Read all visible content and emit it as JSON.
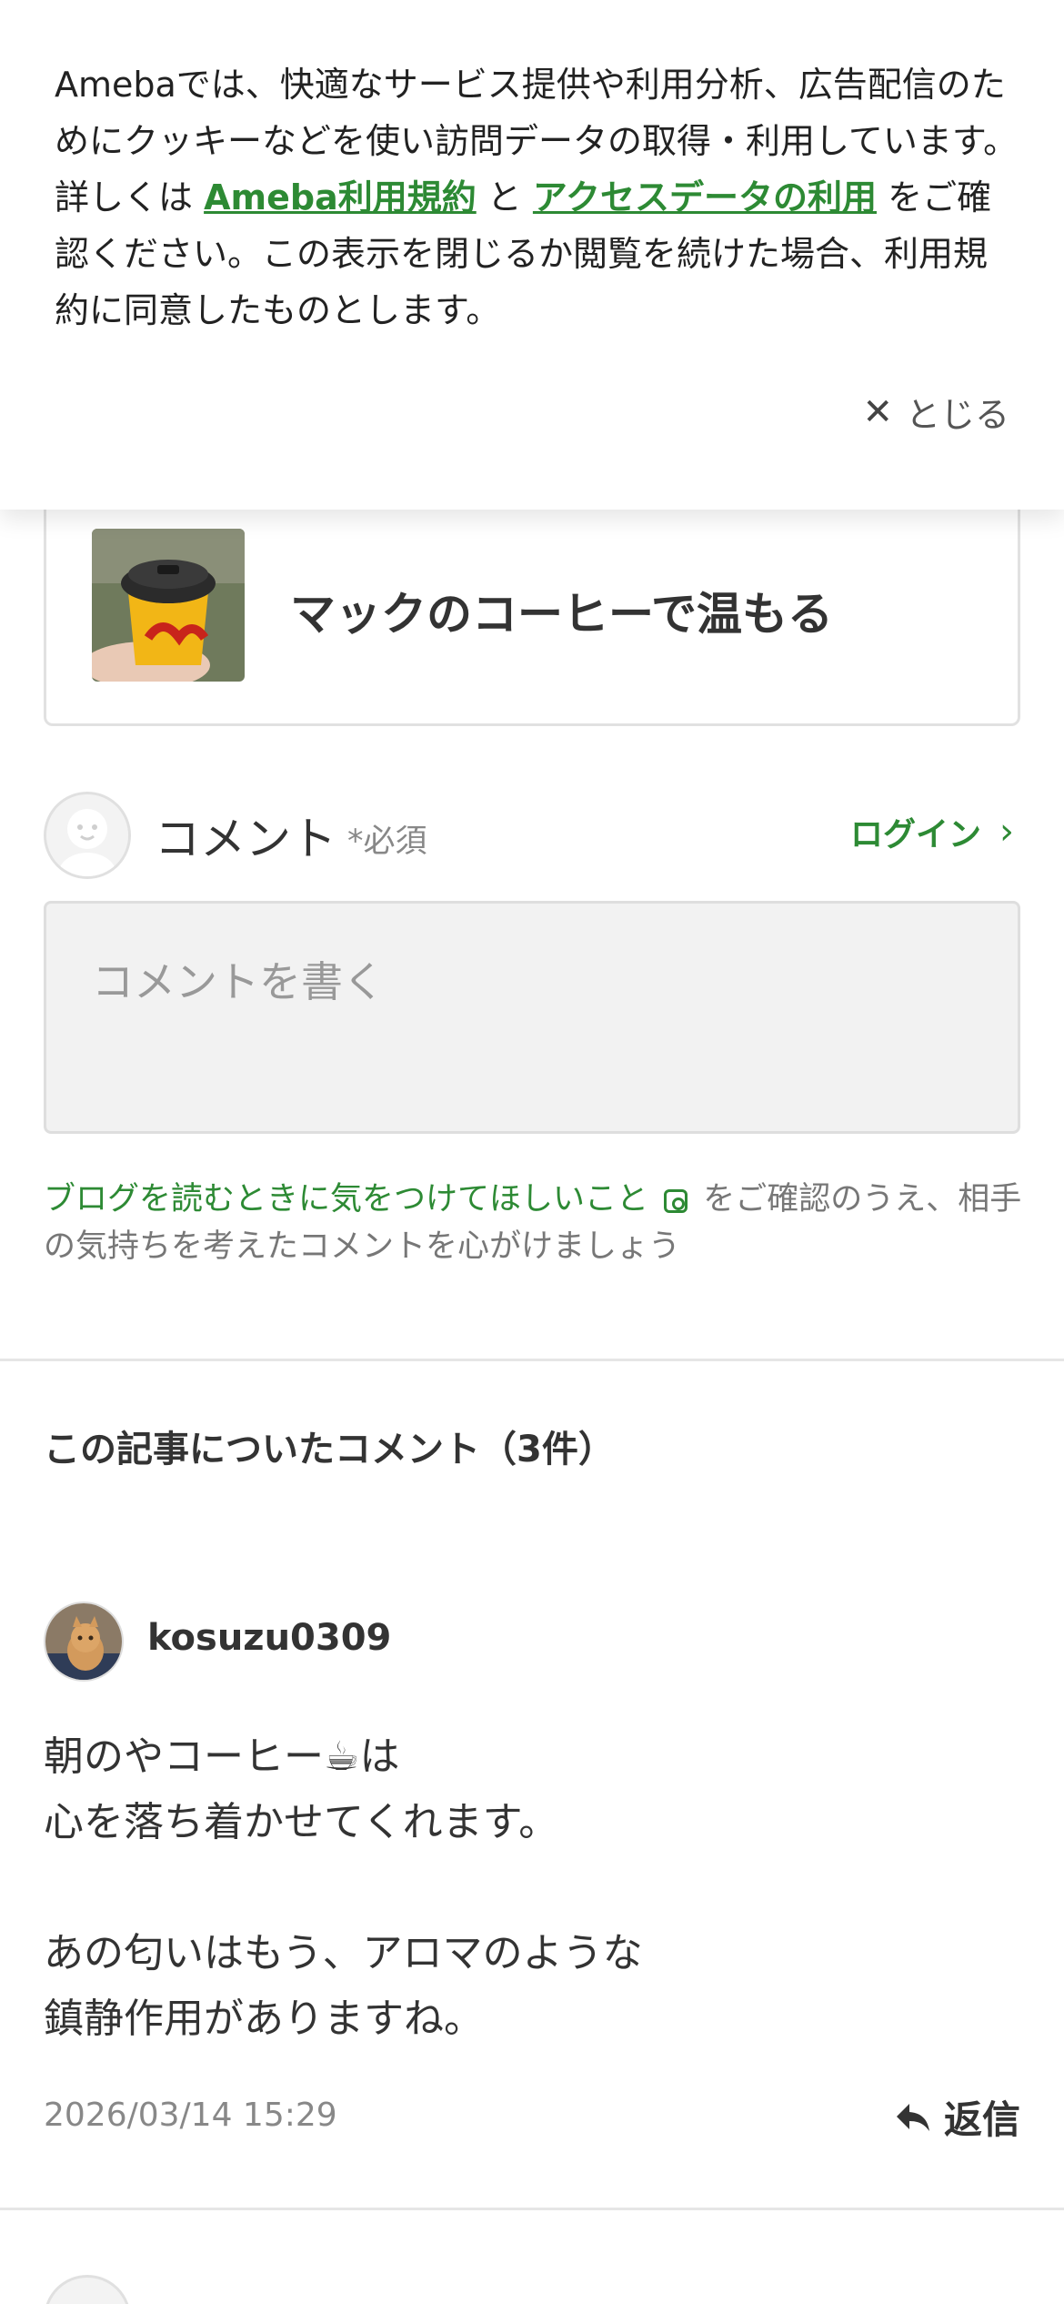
{
  "cookie_banner": {
    "text_1": "Amebaでは、快適なサービス提供や利用分析、広告配信のためにクッキーなどを使い訪問データの取得・利用しています。詳しくは ",
    "link_terms": "Ameba利用規約",
    "text_2": " と ",
    "link_access": "アクセスデータの利用",
    "text_3": " をご確認ください。この表示を閉じるか閲覧を続けた場合、利用規約に同意したものとします。",
    "close_label": "とじる"
  },
  "related_card": {
    "title": "マックのコーヒーで温もる"
  },
  "comment_form": {
    "label": "コメント",
    "required": "*必須",
    "login_label": "ログイン",
    "placeholder": "コメントを書く",
    "note_link": "ブログを読むときに気をつけてほしいこと",
    "note_text": "をご確認のうえ、相手の気持ちを考えたコメントを心がけましょう"
  },
  "comments_section": {
    "title": "この記事についたコメント（3件）",
    "comments": [
      {
        "user": "kosuzu0309",
        "body": "朝のやコーヒー☕は\n心を落ち着かせてくれます。\n\nあの匂いはもう、アロマのような\n鎮静作用がありますね。",
        "date": "2026/03/14 15:29",
        "reply_label": "返信"
      }
    ]
  },
  "colors": {
    "accent_green": "#2d8a34",
    "text": "#333333"
  }
}
